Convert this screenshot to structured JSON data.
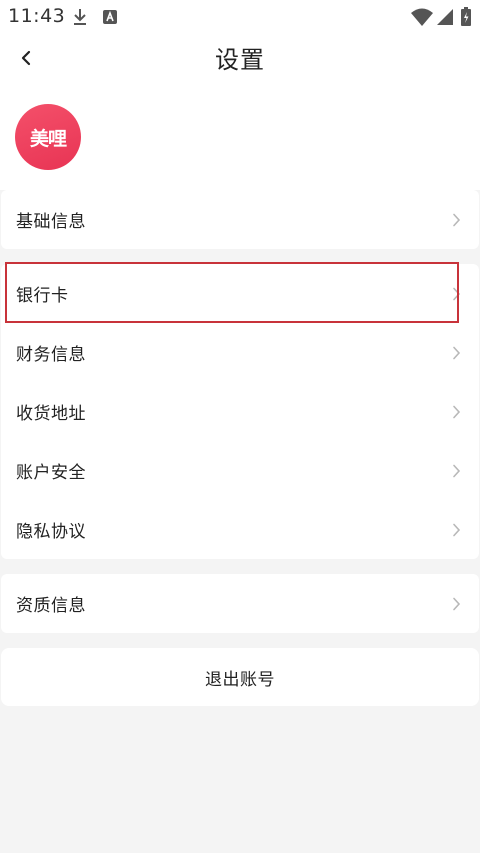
{
  "status_bar": {
    "time": "11:43",
    "left_icons": [
      "download-icon",
      "a-icon"
    ],
    "right_icons": [
      "wifi-icon",
      "signal-icon",
      "battery-icon"
    ]
  },
  "header": {
    "title": "设置"
  },
  "profile": {
    "avatar_text": "美哩",
    "avatar_color": "#ef4461"
  },
  "sections": {
    "basic": {
      "items": [
        {
          "label": "基础信息"
        }
      ]
    },
    "main": {
      "items": [
        {
          "label": "银行卡",
          "highlighted": true
        },
        {
          "label": "财务信息"
        },
        {
          "label": "收货地址"
        },
        {
          "label": "账户安全"
        },
        {
          "label": "隐私协议"
        }
      ]
    },
    "qualification": {
      "items": [
        {
          "label": "资质信息"
        }
      ]
    }
  },
  "logout": {
    "label": "退出账号"
  },
  "colors": {
    "background": "#f4f4f4",
    "card": "#ffffff",
    "highlight_border": "#c8333a",
    "chevron": "#b8b8b8"
  }
}
